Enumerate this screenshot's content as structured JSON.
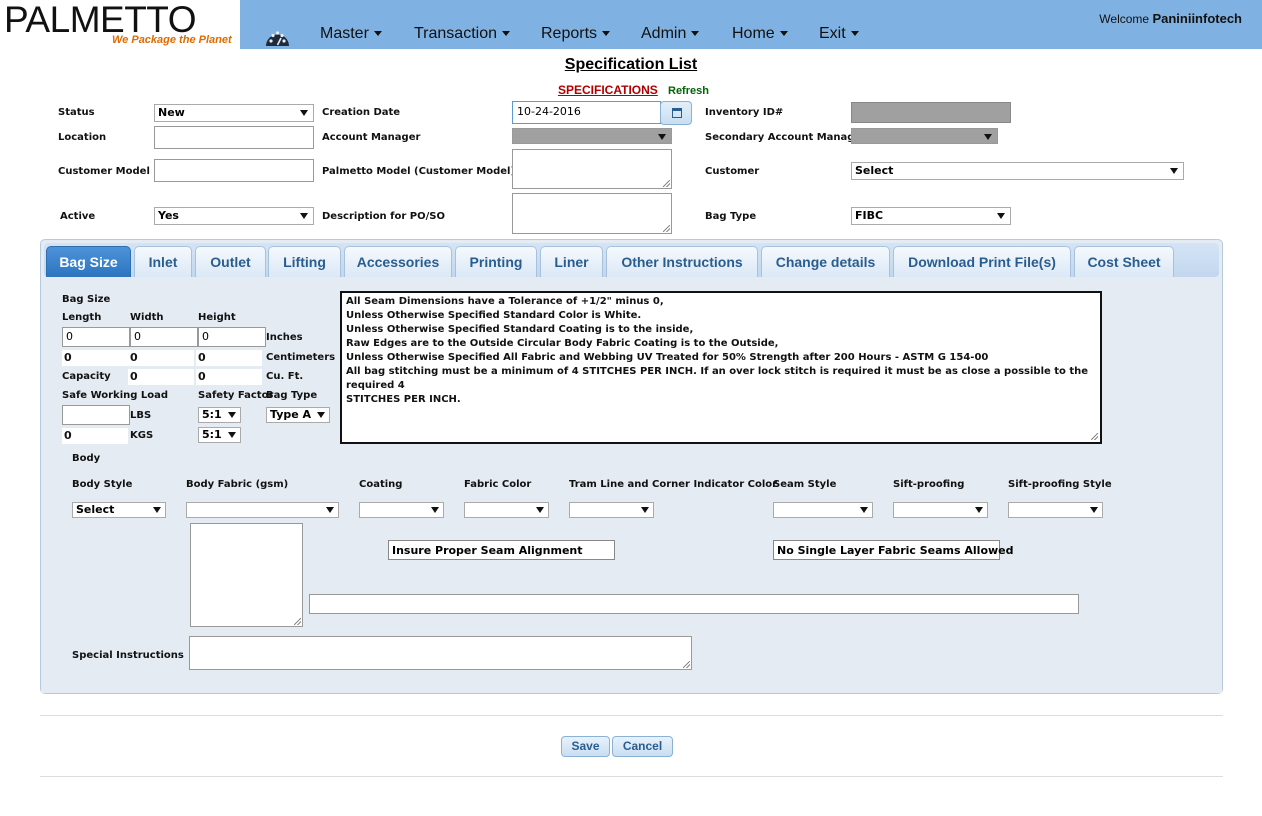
{
  "app": {
    "logo_text": "PALMETTO",
    "tagline": "We Package the Planet",
    "welcome_prefix": "Welcome",
    "welcome_user": "Paniniinfotech"
  },
  "nav": {
    "items": [
      {
        "label": "Master"
      },
      {
        "label": "Transaction"
      },
      {
        "label": "Reports"
      },
      {
        "label": "Admin"
      },
      {
        "label": "Home"
      },
      {
        "label": "Exit"
      }
    ]
  },
  "page": {
    "title": "Specification List",
    "spec_link": "SPECIFICATIONS",
    "refresh": "Refresh"
  },
  "form": {
    "status_label": "Status",
    "status_value": "New",
    "creation_date_label": "Creation Date",
    "creation_date_value": "10-24-2016",
    "inventory_label": "Inventory ID#",
    "location_label": "Location",
    "account_manager_label": "Account Manager",
    "secondary_manager_label": "Secondary Account Manager",
    "customer_model_label": "Customer Model #",
    "palmetto_model_label": "Palmetto Model (Customer Model)#",
    "customer_label": "Customer",
    "customer_value": "Select",
    "active_label": "Active",
    "active_value": "Yes",
    "description_label": "Description for PO/SO",
    "bag_type_label": "Bag Type",
    "bag_type_value": "FIBC"
  },
  "tabs": [
    {
      "label": "Bag Size",
      "active": true
    },
    {
      "label": "Inlet"
    },
    {
      "label": "Outlet"
    },
    {
      "label": "Lifting"
    },
    {
      "label": "Accessories"
    },
    {
      "label": "Printing"
    },
    {
      "label": "Liner"
    },
    {
      "label": "Other Instructions"
    },
    {
      "label": "Change details"
    },
    {
      "label": "Download Print File(s)"
    },
    {
      "label": "Cost Sheet"
    }
  ],
  "bag_size": {
    "section_label": "Bag Size",
    "length_label": "Length",
    "width_label": "Width",
    "height_label": "Height",
    "length_in": "0",
    "width_in": "0",
    "height_in": "0",
    "inches_label": "Inches",
    "length_cm": "0",
    "width_cm": "0",
    "height_cm": "0",
    "cm_label": "Centimeters",
    "capacity_label": "Capacity",
    "capacity_a": "0",
    "capacity_b": "0",
    "cuft_label": "Cu. Ft.",
    "swl_label": "Safe Working Load",
    "safety_factor_label": "Safety Factor",
    "bag_type_label": "Bag Type",
    "lbs_label": "LBS",
    "sf_lbs": "5:1",
    "bag_type_value": "Type A",
    "kgs_value": "0",
    "kgs_label": "KGS",
    "sf_kgs": "5:1"
  },
  "notes": [
    "All Seam Dimensions have a Tolerance of +1/2\" minus 0,",
    "Unless Otherwise Specified Standard Color is White.",
    "Unless Otherwise Specified Standard Coating is to the inside,",
    "Raw Edges are to the Outside Circular Body Fabric Coating is to the Outside,",
    "Unless Otherwise Specified All Fabric and Webbing UV Treated for 50% Strength after 200 Hours - ASTM G 154-00",
    "All bag stitching must be a minimum of 4 STITCHES PER INCH. If an over lock stitch is required it must be as close a possible to the required 4",
    "STITCHES PER INCH."
  ],
  "body": {
    "section_label": "Body",
    "body_style_label": "Body Style",
    "body_style_value": "Select",
    "body_fabric_label": "Body Fabric (gsm)",
    "coating_label": "Coating",
    "fabric_color_label": "Fabric Color",
    "tram_line_label": "Tram Line and Corner Indicator Color",
    "seam_style_label": "Seam Style",
    "sift_proofing_label": "Sift-proofing",
    "sift_proofing_style_label": "Sift-proofing Style",
    "seam_alignment": "Insure Proper Seam Alignment",
    "no_single_layer": "No Single Layer Fabric Seams Allowed",
    "special_instructions_label": "Special Instructions"
  },
  "actions": {
    "save": "Save",
    "cancel": "Cancel"
  }
}
